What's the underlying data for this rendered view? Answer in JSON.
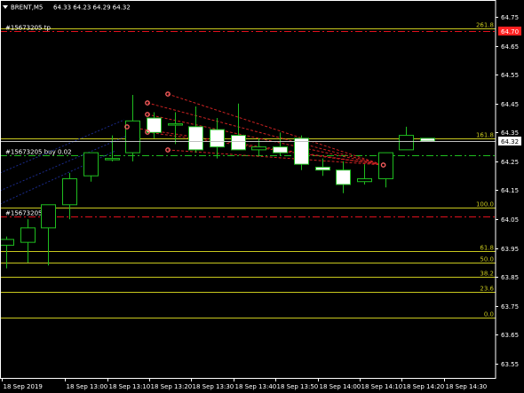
{
  "header": {
    "symbol": "BRENT,M5",
    "quote": "64.33 64.23 64.29 64.32"
  },
  "colors": {
    "background": "#000000",
    "frame": "#ffffff",
    "bull_body": "#000000",
    "bear_body": "#ffffff",
    "candle": "#1fbd1f",
    "fib": "#c8c81e",
    "order_red": "#e0101c",
    "order_green": "#1fbd1f",
    "price_line": "#c0c0c0",
    "label_red": "#ff2020",
    "trend_red": "#cc2222",
    "arrow_marker": "#ff6060"
  },
  "orders": [
    {
      "label": "#15673205 tp",
      "price": 64.7,
      "color": "order_red",
      "style": "dashdot"
    },
    {
      "label": "#15673205 buy 0.02",
      "price": 64.27,
      "color": "order_green",
      "style": "dashdot"
    },
    {
      "label": "#15673205",
      "price": 64.06,
      "color": "order_red",
      "style": "dashdot"
    }
  ],
  "current_price": {
    "value": 64.32,
    "label": "64.32"
  },
  "tp_price_label": "64.70",
  "chart_data": {
    "type": "candlestick",
    "title": "BRENT,M5",
    "ylim": [
      63.49,
      64.79
    ],
    "y_ticks": [
      {
        "value": 64.75,
        "label": "64.75"
      },
      {
        "value": 64.65,
        "label": "64.65"
      },
      {
        "value": 64.55,
        "label": "64.55"
      },
      {
        "value": 64.45,
        "label": "64.45"
      },
      {
        "value": 64.35,
        "label": "64.35"
      },
      {
        "value": 64.25,
        "label": "64.25"
      },
      {
        "value": 64.15,
        "label": "64.15"
      },
      {
        "value": 64.05,
        "label": "64.05"
      },
      {
        "value": 63.95,
        "label": "63.95"
      },
      {
        "value": 63.85,
        "label": "63.85"
      },
      {
        "value": 63.75,
        "label": "63.75"
      },
      {
        "value": 63.65,
        "label": "63.65"
      },
      {
        "value": 63.55,
        "label": "63.55"
      }
    ],
    "x_ticks": [
      {
        "index": 0,
        "label": "18 Sep 2019"
      },
      {
        "index": 3,
        "label": "18 Sep 13:00"
      },
      {
        "index": 5,
        "label": "18 Sep 13:10"
      },
      {
        "index": 7,
        "label": "18 Sep 13:20"
      },
      {
        "index": 9,
        "label": "18 Sep 13:30"
      },
      {
        "index": 11,
        "label": "18 Sep 13:40"
      },
      {
        "index": 13,
        "label": "18 Sep 13:50"
      },
      {
        "index": 15,
        "label": "18 Sep 14:00"
      },
      {
        "index": 17,
        "label": "18 Sep 14:10"
      },
      {
        "index": 19,
        "label": "18 Sep 14:20"
      },
      {
        "index": 21,
        "label": "18 Sep 14:30"
      }
    ],
    "candles": [
      {
        "open": 63.96,
        "high": 63.99,
        "low": 63.88,
        "close": 63.98
      },
      {
        "open": 63.97,
        "high": 64.05,
        "low": 63.9,
        "close": 64.02
      },
      {
        "open": 64.02,
        "high": 64.08,
        "low": 63.89,
        "close": 64.1
      },
      {
        "open": 64.1,
        "high": 64.21,
        "low": 64.05,
        "close": 64.19
      },
      {
        "open": 64.2,
        "high": 64.28,
        "low": 64.18,
        "close": 64.28
      },
      {
        "open": 64.26,
        "high": 64.34,
        "low": 64.25,
        "close": 64.26
      },
      {
        "open": 64.28,
        "high": 64.48,
        "low": 64.25,
        "close": 64.39
      },
      {
        "open": 64.4,
        "high": 64.42,
        "low": 64.33,
        "close": 64.35
      },
      {
        "open": 64.38,
        "high": 64.42,
        "low": 64.31,
        "close": 64.38
      },
      {
        "open": 64.37,
        "high": 64.44,
        "low": 64.28,
        "close": 64.29
      },
      {
        "open": 64.36,
        "high": 64.4,
        "low": 64.26,
        "close": 64.3
      },
      {
        "open": 64.34,
        "high": 64.45,
        "low": 64.29,
        "close": 64.29
      },
      {
        "open": 64.29,
        "high": 64.33,
        "low": 64.27,
        "close": 64.3
      },
      {
        "open": 64.3,
        "high": 64.35,
        "low": 64.27,
        "close": 64.28
      },
      {
        "open": 64.33,
        "high": 64.34,
        "low": 64.22,
        "close": 64.24
      },
      {
        "open": 64.23,
        "high": 64.26,
        "low": 64.2,
        "close": 64.22
      },
      {
        "open": 64.22,
        "high": 64.25,
        "low": 64.14,
        "close": 64.17
      },
      {
        "open": 64.18,
        "high": 64.24,
        "low": 64.17,
        "close": 64.19
      },
      {
        "open": 64.19,
        "high": 64.28,
        "low": 64.16,
        "close": 64.28
      },
      {
        "open": 64.29,
        "high": 64.37,
        "low": 64.29,
        "close": 64.34
      },
      {
        "open": 64.33,
        "high": 64.33,
        "low": 64.32,
        "close": 64.32
      }
    ],
    "fib_levels": [
      {
        "label": "261.8",
        "price": 64.71
      },
      {
        "label": "161.8",
        "price": 64.33
      },
      {
        "label": "100.0",
        "price": 64.09
      },
      {
        "label": "61.8",
        "price": 63.94
      },
      {
        "label": "50.0",
        "price": 63.9
      },
      {
        "label": "38.2",
        "price": 63.85
      },
      {
        "label": "23.6",
        "price": 63.8
      },
      {
        "label": "0.0",
        "price": 63.71
      }
    ]
  }
}
